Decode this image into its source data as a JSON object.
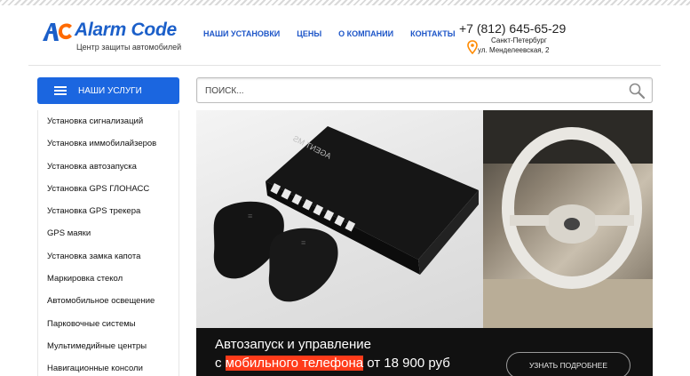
{
  "header": {
    "logo_text": "Alarm Code",
    "logo_tagline": "Центр защиты автомобилей",
    "nav": [
      {
        "label": "Наши установки"
      },
      {
        "label": "Цены"
      },
      {
        "label": "О компании"
      },
      {
        "label": "Контакты"
      }
    ],
    "phone": "+7 (812) 645-65-29",
    "city": "Санкт-Петербург",
    "address": "ул. Менделеевская, 2"
  },
  "services": {
    "button_label": "Наши услуги",
    "items": [
      {
        "label": "Установка сигнализаций"
      },
      {
        "label": "Установка иммобилайзеров"
      },
      {
        "label": "Установка автозапуска"
      },
      {
        "label": "Установка GPS ГЛОНАСС"
      },
      {
        "label": "Установка GPS трекера"
      },
      {
        "label": "GPS маяки"
      },
      {
        "label": "Установка замка капота"
      },
      {
        "label": "Маркировка стекол"
      },
      {
        "label": "Автомобильное освещение"
      },
      {
        "label": "Парковочные системы"
      },
      {
        "label": "Мультимедийные центры"
      },
      {
        "label": "Навигационные консоли"
      }
    ]
  },
  "search": {
    "placeholder": "Поиск...",
    "value": ""
  },
  "banner": {
    "device_label": "AGENT MS",
    "caption_line1": "Автозапуск и управление",
    "caption_prefix": "с ",
    "caption_highlight": "мобильного телефона",
    "caption_suffix": " от 18 900 руб",
    "more_label": "Узнать подробнее"
  },
  "colors": {
    "brand_blue": "#1b66e0",
    "logo_orange": "#ff6a00",
    "highlight_red": "#ff3b1a"
  },
  "icons": [
    "logo-mark-icon",
    "menu-icon",
    "map-pin-icon",
    "search-icon"
  ]
}
